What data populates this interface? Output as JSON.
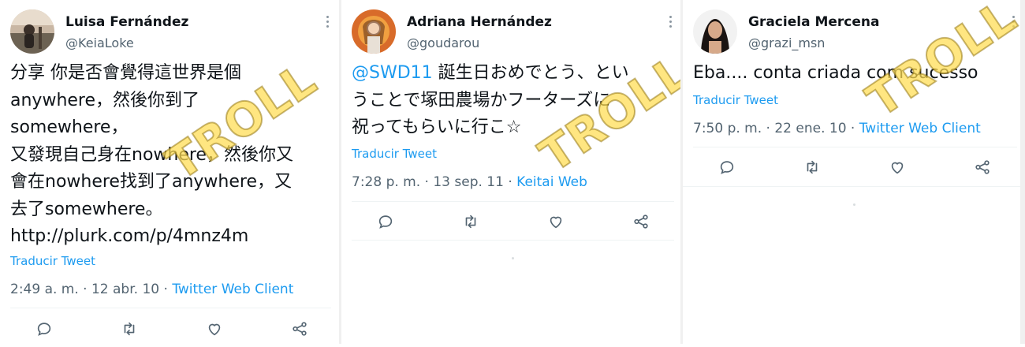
{
  "tweets": [
    {
      "name": "Luisa Fernández",
      "handle": "@KeiaLoke",
      "text": "分享 你是否會覺得這世界是個\nanywhere，然後你到了\nsomewhere，\n又發現自己身在nowhere，然後你又\n會在nowhere找到了anywhere，又\n去了somewhere。\nhttp://plurk.com/p/4mnz4m",
      "translate": "Traducir Tweet",
      "time": "2:49 a. m. · 12 abr. 10 · ",
      "source": "Twitter Web Client",
      "stamp": "TROLL"
    },
    {
      "name": "Adriana Hernández",
      "handle": "@goudarou",
      "mention": "@SWD11",
      "text": " 誕生日おめでとう、とい\nうことで塚田農場かフーターズに\n祝ってもらいに行こ☆",
      "translate": "Traducir Tweet",
      "time": "7:28 p. m. · 13 sep. 11 · ",
      "source": "Keitai Web",
      "stamp": "TROLL"
    },
    {
      "name": "Graciela Mercena",
      "handle": "@grazi_msn",
      "text": "Eba.... conta criada com sucesso",
      "translate": "Traducir Tweet",
      "time": "7:50 p. m. · 22 ene. 10 · ",
      "source": "Twitter Web Client",
      "stamp": "TROLL"
    }
  ],
  "icons": [
    "more-icon",
    "reply-icon",
    "retweet-icon",
    "like-icon",
    "share-icon"
  ],
  "colors": {
    "link": "#1d9bf0",
    "secondary": "#536471",
    "stamp": "#ffdd50"
  }
}
